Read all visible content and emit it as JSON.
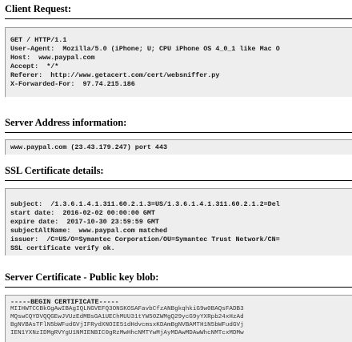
{
  "client_request": {
    "heading": "Client Request:",
    "lines": [
      {
        "text": "GET / HTTP/1.1"
      },
      {
        "key": "User-Agent:",
        "value": "  Mozilla/5.0 (iPhone; U; CPU iPhone OS 4_0_1 like Mac O"
      },
      {
        "key": "Host:",
        "value": "  www.paypal.com"
      },
      {
        "key": "Accept:",
        "value": "  */*"
      },
      {
        "key": "Referer:",
        "value": "  http://www.getacert.com/cert/websniffer.py"
      },
      {
        "key": "X-Forwarded-For:",
        "value": "  97.74.215.186"
      }
    ]
  },
  "server_address": {
    "heading": "Server Address information:",
    "line": "www.paypal.com (23.43.179.247) port 443"
  },
  "ssl_details": {
    "heading": "SSL Certificate details:",
    "lines": [
      {
        "key": "subject:",
        "value": "  /1.3.6.1.4.1.311.60.2.1.3=US/1.3.6.1.4.1.311.60.2.1.2=Del"
      },
      {
        "key": "start date:",
        "value": "  2016-02-02 00:00:00 GMT"
      },
      {
        "key": "expire date:",
        "value": "  2017-10-30 23:59:59 GMT"
      },
      {
        "key": "subjectAltName:",
        "value": "  www.paypal.com matched"
      },
      {
        "key": "issuer:",
        "value": "  /C=US/O=Symantec Corporation/OU=Symantec Trust Network/CN="
      },
      {
        "text": "SSL certificate verify ok."
      }
    ]
  },
  "public_key": {
    "heading": "Server Certificate - Public key blob:",
    "lines": [
      "-----BEGIN CERTIFICATE-----",
      "MIIHWTCCBkGgAwIBAgIQLNGVEFQ3ONSKOSAFavbCfzANBgkqhkiG9w0BAQsFADB3",
      "MQswCQYDVQQGEwJVUzEdMBsGA1UEChMUU31tYW50ZWMgQ29ycG9yYXRpb24xHzAd",
      "BgNVBAsTFlN5bWFudGVjIFRydXNOIE51dHdvcmsxKDAmBgNVBAMTH1N5bWFudGVj",
      "IEN1YXNzIDMgRVYgU1NMIENBIC0gRzMwHhcNMTYwMjAyMDAwMDAwWhcNMTcxMDMw"
    ]
  }
}
